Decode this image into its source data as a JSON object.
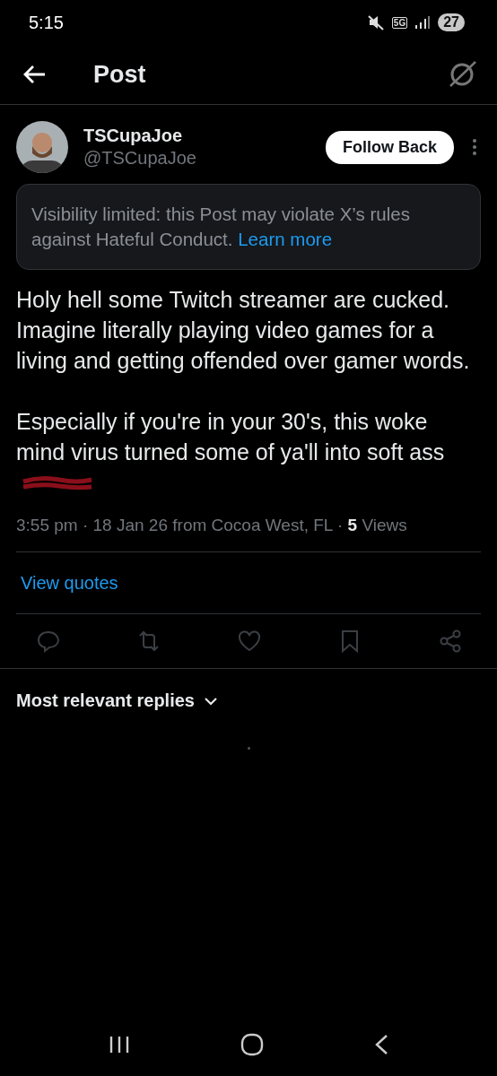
{
  "status_bar": {
    "time": "5:15",
    "network": "5G",
    "battery": "27"
  },
  "header": {
    "title": "Post"
  },
  "author": {
    "name": "TSCupaJoe",
    "handle": "@TSCupaJoe",
    "follow_button": "Follow Back"
  },
  "notice": {
    "text": "Visibility limited: this Post may violate X’s rules against Hateful Conduct.",
    "link": "Learn more"
  },
  "body": [
    {
      "text": "Holy hell some Twitch streamer are cucked. Imagine literally playing video games for a living and getting offended over gamer words.",
      "redacted": false
    },
    {
      "text": "Especially if you're in your 30's, this woke mind virus turned some of ya'll into soft ass",
      "redacted": true
    }
  ],
  "meta": "3:55 pm · 18 Jan 26 from Cocoa West, FL · **5** Views",
  "view_quotes": "View quotes",
  "replies_sort": {
    "label": "Most relevant replies",
    "expanded": false
  }
}
